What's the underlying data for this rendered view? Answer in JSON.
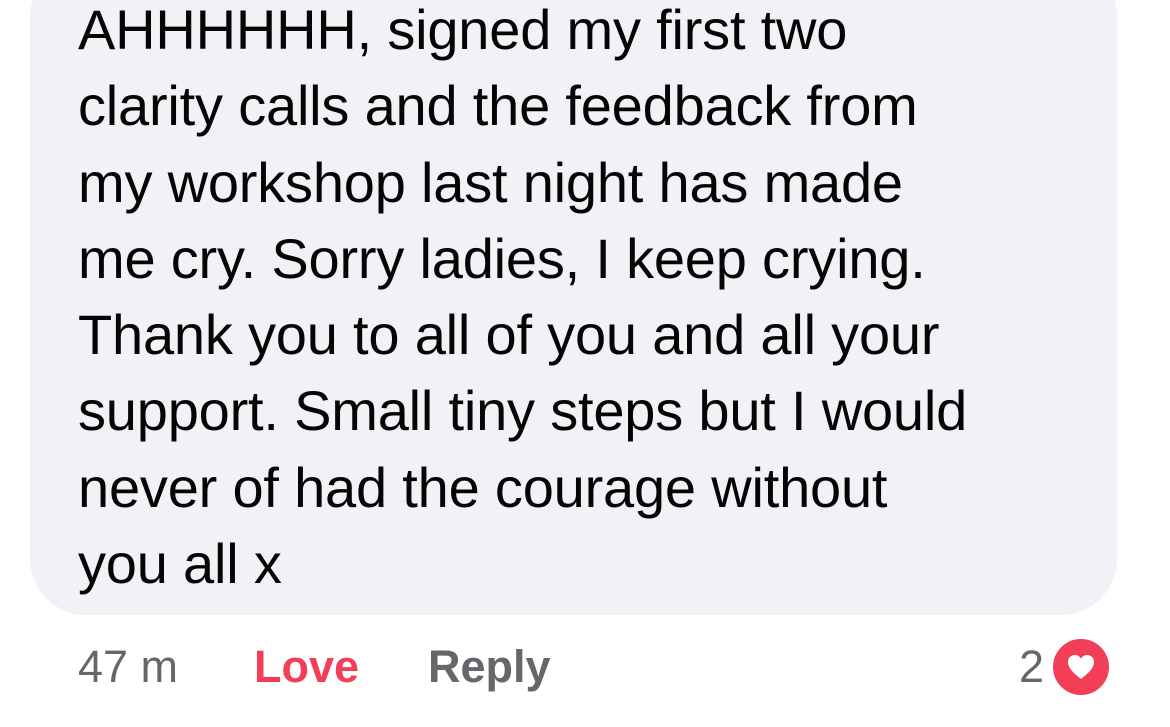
{
  "comment": {
    "text": "AHHHHHH, signed my first two\nclarity calls and the feedback from\nmy workshop last night has made\nme cry. Sorry ladies, I keep crying.\nThank you to all of you and all your\nsupport. Small tiny steps but I would\nnever of had the courage without\nyou all x"
  },
  "actions": {
    "timestamp": "47 m",
    "love_label": "Love",
    "reply_label": "Reply"
  },
  "reactions": {
    "count": "2",
    "icon": "heart-icon",
    "color": "#f33e58"
  },
  "colors": {
    "bubble_background": "#f0f2f5",
    "text_primary": "#050505",
    "text_secondary": "#65676b",
    "love_accent": "#f33e58"
  }
}
